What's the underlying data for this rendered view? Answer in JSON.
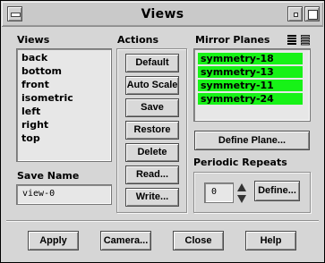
{
  "window": {
    "title": "Views"
  },
  "views_panel": {
    "heading": "Views",
    "items": [
      "back",
      "bottom",
      "front",
      "isometric",
      "left",
      "right",
      "top"
    ]
  },
  "save_name": {
    "label": "Save Name",
    "value": "view-0"
  },
  "actions_panel": {
    "heading": "Actions",
    "buttons": [
      "Default",
      "Auto Scale",
      "Save",
      "Restore",
      "Delete",
      "Read...",
      "Write..."
    ]
  },
  "mirror_planes": {
    "heading": "Mirror Planes",
    "items": [
      "symmetry-18",
      "symmetry-13",
      "symmetry-11",
      "symmetry-24"
    ],
    "selected_color": "#17f217",
    "select_all_icon": "select-all-icon",
    "deselect_all_icon": "deselect-all-icon"
  },
  "define_plane_button": "Define Plane...",
  "periodic_repeats": {
    "label": "Periodic Repeats",
    "value": "0",
    "define_button": "Define..."
  },
  "bottom_buttons": {
    "apply": "Apply",
    "camera": "Camera...",
    "close": "Close",
    "help": "Help"
  }
}
